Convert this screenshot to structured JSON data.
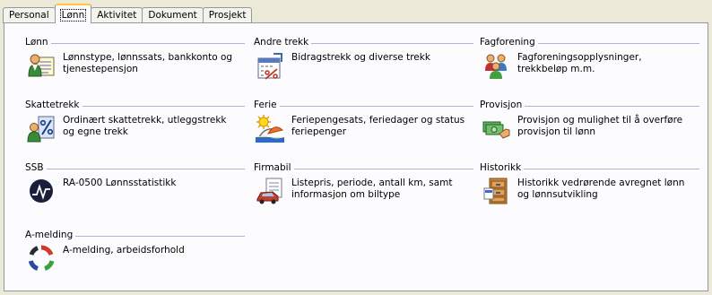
{
  "tabs": [
    {
      "label": "Personal",
      "active": false
    },
    {
      "label": "Lønn",
      "active": true
    },
    {
      "label": "Aktivitet",
      "active": false
    },
    {
      "label": "Dokument",
      "active": false
    },
    {
      "label": "Prosjekt",
      "active": false
    }
  ],
  "groups": {
    "lonn": {
      "title": "Lønn",
      "desc": "Lønnstype, lønnssats, bankkonto og tjenestepensjon",
      "icon": "employee-card-icon"
    },
    "andre_trekk": {
      "title": "Andre trekk",
      "desc": "Bidragstrekk og diverse trekk",
      "icon": "calendar-percent-icon"
    },
    "fagforening": {
      "title": "Fagforening",
      "desc": "Fagforeningsopplysninger, trekkbeløp m.m.",
      "icon": "people-group-icon"
    },
    "skattetrekk": {
      "title": "Skattetrekk",
      "desc": "Ordinært skattetrekk, utleggstrekk og egne trekk",
      "icon": "person-percent-icon"
    },
    "ferie": {
      "title": "Ferie",
      "desc": "Feriepengesats, feriedager og status feriepenger",
      "icon": "sun-beach-icon"
    },
    "provisjon": {
      "title": "Provisjon",
      "desc": "Provisjon og mulighet til å overføre provisjon til lønn",
      "icon": "money-hand-icon"
    },
    "ssb": {
      "title": "SSB",
      "desc": "RA-0500 Lønnsstatistikk",
      "icon": "statistics-logo-icon"
    },
    "firmabil": {
      "title": "Firmabil",
      "desc": "Listepris, periode, antall km, samt informasjon om biltype",
      "icon": "car-document-icon"
    },
    "historikk": {
      "title": "Historikk",
      "desc": "Historikk vedrørende avregnet lønn og lønnsutvikling",
      "icon": "filing-cabinet-icon"
    },
    "a_melding": {
      "title": "A-melding",
      "desc": "A-melding, arbeidsforhold",
      "icon": "a-melding-ring-icon"
    }
  }
}
